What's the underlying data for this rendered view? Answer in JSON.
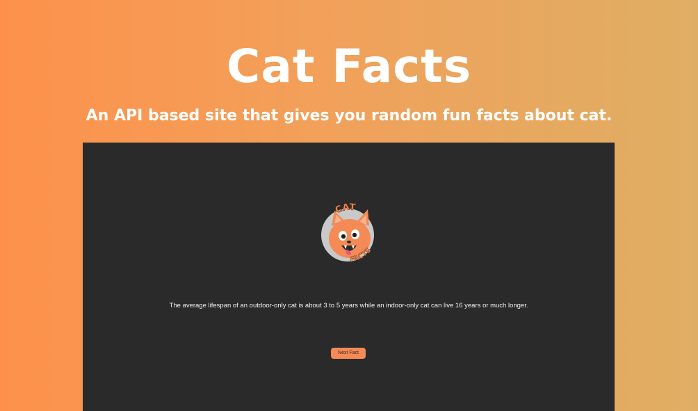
{
  "hero": {
    "title": "Cat Facts",
    "subtitle": "An API based site that gives you random fun facts about cat."
  },
  "app": {
    "logo": {
      "icon": "cat-facts-logo-icon",
      "top_text": "CAT",
      "bottom_text": "FACTS"
    },
    "fact": "The average lifespan of an outdoor-only cat is about 3 to 5 years while an indoor-only cat can live 16 years or much longer.",
    "next_button_label": "Next Fact"
  },
  "colors": {
    "gradient_start": "#fd914b",
    "gradient_end": "#dfae64",
    "panel_background": "#2a2a2a",
    "accent": "#f48a55",
    "text_light": "#ffffff"
  }
}
